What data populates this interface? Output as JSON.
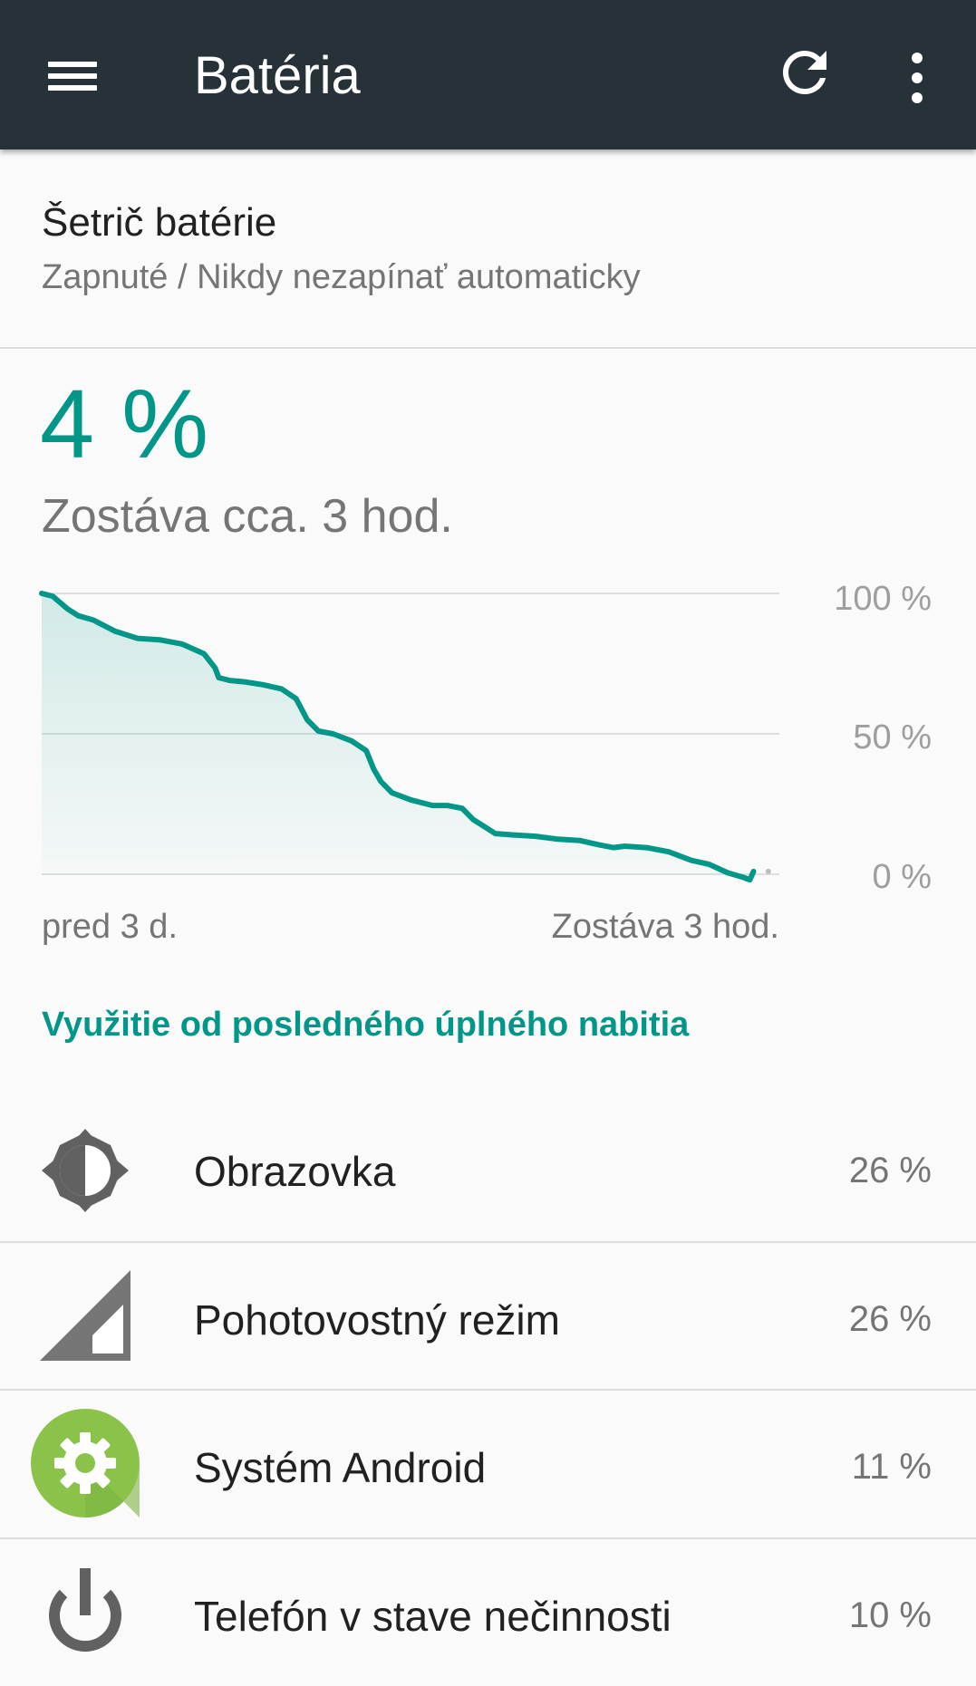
{
  "appbar": {
    "title": "Batéria",
    "menu_icon": "hamburger-menu-icon",
    "refresh_icon": "refresh-icon",
    "more_icon": "more-vert-icon",
    "color": "#263238"
  },
  "battery_saver": {
    "title": "Šetrič batérie",
    "summary": "Zapnuté / Nikdy nezapínať automaticky"
  },
  "battery": {
    "level": "4 %",
    "remaining": "Zostáva cca. 3 hod.",
    "accent_color": "#009688"
  },
  "chart_data": {
    "type": "area",
    "y_tick_labels": [
      "100 %",
      "50 %",
      "0 %"
    ],
    "x_start_label": "pred 3 d.",
    "x_end_label": "Zostáva 3 hod.",
    "ylim": [
      0,
      100
    ],
    "xlim": [
      0,
      100
    ],
    "grid": true,
    "series": [
      {
        "x": [
          0,
          1.5,
          3.5,
          5,
          7,
          10,
          13,
          16,
          19,
          22,
          23.5,
          24,
          25.5,
          27.5,
          30,
          32.5,
          34.5,
          36,
          37.5,
          39.5,
          42,
          44,
          45,
          46,
          47.5,
          50,
          53,
          55,
          57,
          58.5,
          60,
          61.5,
          64,
          67,
          70,
          73,
          75.5,
          77.5,
          79,
          82,
          85,
          88,
          90.5,
          93,
          95,
          96,
          96.5
        ],
        "y": [
          100,
          99,
          94.5,
          92,
          90.5,
          86.5,
          84,
          83.5,
          82,
          78.5,
          73.5,
          70,
          69,
          68.5,
          67.5,
          66,
          62.5,
          55,
          51,
          50,
          47.5,
          44,
          37.5,
          33,
          29,
          26.5,
          24.5,
          24.5,
          23.5,
          19.5,
          17,
          14.5,
          14,
          13.5,
          12.5,
          12,
          10.5,
          9.5,
          10,
          9.5,
          8,
          5,
          3.5,
          0.5,
          -1,
          -2,
          1
        ]
      }
    ],
    "end_marker": {
      "x": 98.5,
      "y": 1
    }
  },
  "usage": {
    "header": "Využitie od posledného úplného nabitia",
    "items": [
      {
        "label": "Obrazovka",
        "percent": "26 %",
        "icon": "brightness-icon"
      },
      {
        "label": "Pohotovostný režim",
        "percent": "26 %",
        "icon": "cell-signal-icon"
      },
      {
        "label": "Systém Android",
        "percent": "11 %",
        "icon": "android-system-icon"
      },
      {
        "label": "Telefón v stave nečinnosti",
        "percent": "10 %",
        "icon": "power-icon"
      }
    ]
  }
}
